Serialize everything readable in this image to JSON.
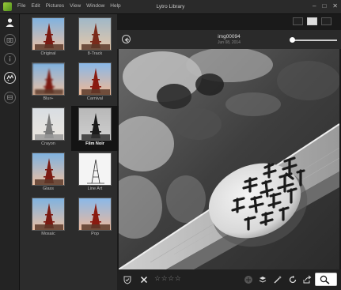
{
  "window": {
    "title": "Lytro Library",
    "menu": [
      "File",
      "Edit",
      "Pictures",
      "View",
      "Window",
      "Help"
    ],
    "controls": [
      "minimize-icon",
      "maximize-icon",
      "close-icon"
    ]
  },
  "left_rail": {
    "icons": [
      "person-icon",
      "camera-icon",
      "info-icon",
      "filter-icon",
      "refocus-icon"
    ]
  },
  "filters": [
    {
      "label": "Original"
    },
    {
      "label": "8-Track"
    },
    {
      "label": "Blur+"
    },
    {
      "label": "Carnival"
    },
    {
      "label": "Crayon"
    },
    {
      "label": "Film Noir",
      "selected": true
    },
    {
      "label": "Glass"
    },
    {
      "label": "Line Art"
    },
    {
      "label": "Mosaic"
    },
    {
      "label": "Pop"
    }
  ],
  "viewer": {
    "image_name": "img00094",
    "image_date": "Jun 08, 2014"
  },
  "bottom_bar": {
    "rating": "☆☆☆☆",
    "icons": [
      "shield-icon",
      "reject-icon",
      "perspective-icon",
      "layers-icon",
      "magic-wand-icon",
      "rotate-icon",
      "share-icon",
      "living-picture-icon"
    ]
  },
  "colors": {
    "accent": "#9ccc3a",
    "panel": "#2c2c2c",
    "bg": "#1a1a1a"
  }
}
